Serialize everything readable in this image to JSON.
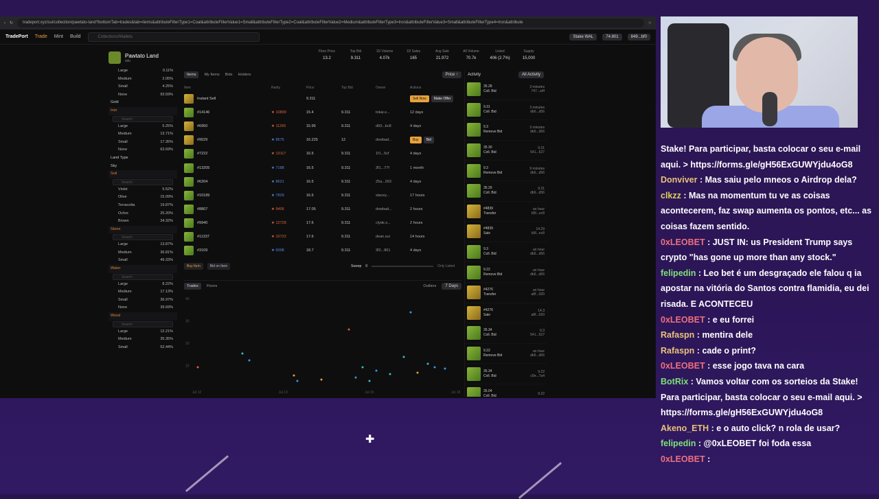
{
  "browser": {
    "url": "tradeport.xyz/sui/collection/pawtato-land?bottomTab=trades&tab=items&attributeFilterType1=Coal&attributeFilterValue1=Small&attributeFilterType2=Coal&attributeFilterValue2=Medium&attributeFilterType3=Iron&attributeFilterValue3=Small&attributeFilterType4=Iron&attribute"
  },
  "nav": {
    "logo": "TradePort",
    "trade": "Trade",
    "mint": "Mint",
    "build": "Build",
    "search_placeholder": "Collections/Wallets",
    "stake": "Stake WAL",
    "balance": "74.801",
    "wallet": "849...bf0"
  },
  "collection": {
    "name": "Pawtato Land",
    "sub": "sdu"
  },
  "stats": [
    {
      "label": "Floor Price",
      "value": "13.2"
    },
    {
      "label": "Top Bid",
      "value": "9.311"
    },
    {
      "label": "1D Volume",
      "value": "4.07k"
    },
    {
      "label": "1D Sales",
      "value": "165"
    },
    {
      "label": "Avg Sale",
      "value": "21.972"
    },
    {
      "label": "All Volume",
      "value": "70.7k"
    },
    {
      "label": "Listed",
      "value": "406 (2.7%)"
    },
    {
      "label": "Supply",
      "value": "15,000"
    }
  ],
  "filters": {
    "top": [
      {
        "label": "Large",
        "pct": "0.11%"
      },
      {
        "label": "Medium",
        "pct": "2.05%"
      },
      {
        "label": "Small",
        "pct": "4.25%"
      },
      {
        "label": "None",
        "pct": "93.59%"
      }
    ],
    "gold": "Gold",
    "iron": "Iron",
    "search": "Search",
    "iron_items": [
      {
        "label": "Large",
        "pct": "5.25%"
      },
      {
        "label": "Medium",
        "pct": "13.71%"
      },
      {
        "label": "Small",
        "pct": "17.35%"
      },
      {
        "label": "None",
        "pct": "63.69%"
      }
    ],
    "land_type": "Land Type",
    "sky": "Sky",
    "soil": "Soil",
    "soil_items": [
      {
        "label": "Violet",
        "pct": "5.52%"
      },
      {
        "label": "Olive",
        "pct": "15.09%"
      },
      {
        "label": "Terracotta",
        "pct": "19.87%"
      },
      {
        "label": "Ochre",
        "pct": "25.20%"
      },
      {
        "label": "Brown",
        "pct": "34.32%"
      }
    ],
    "stone": "Stone",
    "stone_items": [
      {
        "label": "Large",
        "pct": "13.87%"
      },
      {
        "label": "Medium",
        "pct": "36.81%"
      },
      {
        "label": "Small",
        "pct": "49.33%"
      }
    ],
    "water": "Water",
    "water_items": [
      {
        "label": "Large",
        "pct": "8.22%"
      },
      {
        "label": "Medium",
        "pct": "17.13%"
      },
      {
        "label": "Small",
        "pct": "36.97%"
      },
      {
        "label": "None",
        "pct": "39.69%"
      }
    ],
    "wood": "Wood",
    "wood_items": [
      {
        "label": "Large",
        "pct": "12.21%"
      },
      {
        "label": "Medium",
        "pct": "35.35%"
      },
      {
        "label": "Small",
        "pct": "52.44%"
      }
    ]
  },
  "tabs": [
    "Items",
    "My Items",
    "Bids",
    "Holders"
  ],
  "price_sort": "Price ↑",
  "columns": [
    "Item",
    "Rarity",
    "Price",
    "Top Bid",
    "Owner",
    "Actions"
  ],
  "instant": {
    "label": "Instant Sell",
    "price": "9.311",
    "sell": "Sell Now",
    "offer": "Make Offer"
  },
  "rows": [
    {
      "id": "#14146",
      "rar": "10809",
      "price": "15.4",
      "top": "9.311",
      "own": "tokai.s...",
      "act": "12 days",
      "gold": false
    },
    {
      "id": "#6950",
      "rar": "11265",
      "price": "15.95",
      "top": "9.311",
      "own": "d93...bc8",
      "act": "4 days",
      "gold": true
    },
    {
      "id": "#9529",
      "rar": "8575",
      "price": "16.225",
      "top": "12",
      "own": "dowbad...",
      "act": "",
      "gold": true
    },
    {
      "id": "#7222",
      "rar": "13117",
      "price": "16.5",
      "top": "9.311",
      "own": "1f1...5cf",
      "act": "4 days",
      "gold": false
    },
    {
      "id": "#13205",
      "rar": "7188",
      "price": "16.5",
      "top": "9.311",
      "own": "3f1...77f",
      "act": "1 month",
      "gold": false
    },
    {
      "id": "#6204",
      "rar": "8621",
      "price": "16.5",
      "top": "9.311",
      "own": "25a...263",
      "act": "4 days",
      "gold": false
    },
    {
      "id": "#10189",
      "rar": "7829",
      "price": "16.5",
      "top": "9.311",
      "own": "stacey...",
      "act": "17 hours",
      "gold": false
    },
    {
      "id": "#8807",
      "rar": "9406",
      "price": "17.05",
      "top": "9.311",
      "own": "dowbad...",
      "act": "2 hours",
      "gold": false
    },
    {
      "id": "#9940",
      "rar": "12728",
      "price": "17.6",
      "top": "9.311",
      "own": "clyde.s...",
      "act": "2 hours",
      "gold": false
    },
    {
      "id": "#11337",
      "rar": "10722",
      "price": "17.6",
      "top": "9.311",
      "own": "dean.sui",
      "act": "14 hours",
      "gold": false
    },
    {
      "id": "#3109",
      "rar": "6008",
      "price": "18.7",
      "top": "9.311",
      "own": "3f2...861",
      "act": "4 days",
      "gold": false
    }
  ],
  "buy": "Buy",
  "bid": "Bid",
  "bottom": {
    "buy_item": "Buy Item",
    "bid_item": "Bid on Item",
    "sweep": "Sweep",
    "sweep_val": "0",
    "only_listed": "Only Listed"
  },
  "chart_tabs": [
    "Trades",
    "Floors"
  ],
  "chart_ctrl": {
    "outliers": "Outliers",
    "range": "7 Days"
  },
  "chart_data": {
    "type": "scatter",
    "x_ticks": [
      "Jul 12",
      "Jul 13",
      "Jul 15",
      "Jul 18"
    ],
    "y_ticks": [
      "40",
      "30",
      "20",
      "10"
    ],
    "ylim": [
      0,
      40
    ]
  },
  "activity": {
    "title": "Activity",
    "filter": "All Activity",
    "rows": [
      {
        "t": "Coll. Bid",
        "p": "35.28",
        "time": "3 minutes",
        "who": "747...a4f",
        "gold": false
      },
      {
        "t": "Coll. Bid",
        "p": "9.31",
        "time": "3 minutes",
        "who": "db6...d56",
        "gold": false
      },
      {
        "t": "Remove Bid",
        "p": "9.3",
        "time": "3 minutes",
        "who": "db6...d56",
        "gold": false
      },
      {
        "t": "Coll. Bid",
        "p": "35.30",
        "time": "9.31",
        "who": "541...527",
        "gold": false
      },
      {
        "t": "Remove Bid",
        "p": "9.3",
        "time": "9 minutes",
        "who": "db6...d56",
        "gold": false
      },
      {
        "t": "Coll. Bid",
        "p": "35.29",
        "time": "9.31",
        "who": "db6...d56",
        "gold": false
      },
      {
        "t": "Transfer",
        "p": "#4839",
        "time": "an hour",
        "who": "b5f...ec8",
        "gold": true
      },
      {
        "t": "Sale",
        "p": "#4839",
        "time": "14.29",
        "who": "b5f...ec8",
        "gold": true
      },
      {
        "t": "Coll. Bid",
        "p": "9.3",
        "time": "an hour",
        "who": "db6...d56",
        "gold": false
      },
      {
        "t": "Remove Bid",
        "p": "9.22",
        "time": "an hour",
        "who": "db6...d56",
        "gold": false
      },
      {
        "t": "Transfer",
        "p": "#4276",
        "time": "an hour",
        "who": "a8f...020",
        "gold": true
      },
      {
        "t": "Sale",
        "p": "#4276",
        "time": "14.3",
        "who": "a8f...020",
        "gold": true
      },
      {
        "t": "Coll. Bid",
        "p": "35.34",
        "time": "9.3",
        "who": "541...527",
        "gold": false
      },
      {
        "t": "Remove Bid",
        "p": "9.22",
        "time": "an hour",
        "who": "db6...d56",
        "gold": false
      },
      {
        "t": "Coll. Bid",
        "p": "35.34",
        "time": "9.22",
        "who": "c9e...7a4",
        "gold": false
      },
      {
        "t": "Coll. Bid",
        "p": "35.04",
        "time": "9.22",
        "who": "",
        "gold": false
      }
    ]
  },
  "chat": [
    {
      "u": "",
      "c": "",
      "t": "Stake! Para participar, basta colocar o seu e-mail aqui. > https://forms.gle/gH56ExGUWYjdu4oG8"
    },
    {
      "u": "Donviver",
      "c": "u-gold",
      "t": "Mas saiu pelo mneos o Airdrop dela?"
    },
    {
      "u": "clkzz",
      "c": "u-yellow",
      "t": "Mas na momentum tu ve as coisas acontecerem, faz swap aumenta os pontos, etc... as coisas fazem sentido."
    },
    {
      "u": "0xLEOBET",
      "c": "u-red",
      "t": "JUST IN: us President Trump says crypto \"has gone up more than any stock.\""
    },
    {
      "u": "felipedin",
      "c": "u-green",
      "t": "Leo bet é um desgraçado ele falou q ia apostar na vitória do Santos contra flamidia, eu dei risada. E ACONTECEU"
    },
    {
      "u": "0xLEOBET",
      "c": "u-red",
      "t": "e eu forrei"
    },
    {
      "u": "Rafaspn",
      "c": "u-gold",
      "t": "mentira dele"
    },
    {
      "u": "Rafaspn",
      "c": "u-gold",
      "t": "cade o print?"
    },
    {
      "u": "0xLEOBET",
      "c": "u-red",
      "t": "esse jogo tava na cara"
    },
    {
      "u": "BotRix",
      "c": "u-green",
      "t": "Vamos voltar com os sorteios da Stake! Para participar, basta colocar o seu e-mail aqui. > https://forms.gle/gH56ExGUWYjdu4oG8"
    },
    {
      "u": "Akeno_ETH",
      "c": "u-gold",
      "t": "e o auto click? n rola de usar?"
    },
    {
      "u": "felipedin",
      "c": "u-green",
      "t": "@0xLEOBET foi foda essa"
    },
    {
      "u": "0xLEOBET",
      "c": "u-red",
      "t": ""
    }
  ]
}
